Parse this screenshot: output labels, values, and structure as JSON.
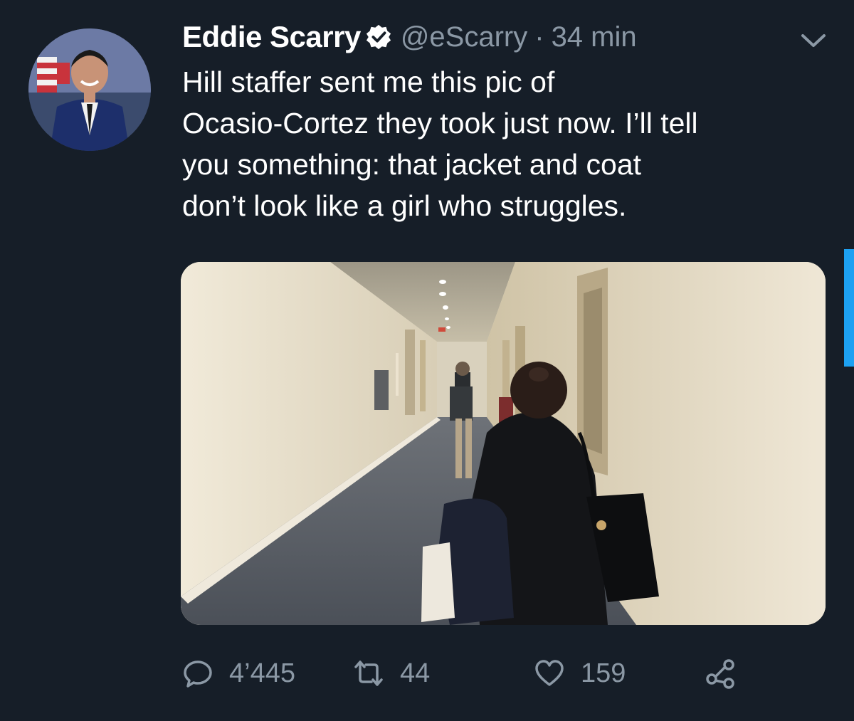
{
  "tweet": {
    "author": {
      "display_name": "Eddie Scarry",
      "handle": "@eScarry",
      "verified": true,
      "avatar_icon": "profile-photo"
    },
    "separator": "·",
    "timestamp": "34 min",
    "text_lines": [
      "Hill staffer sent me this pic of",
      "Ocasio-Cortez they took just now. I’ll tell",
      "you something: that jacket and coat",
      "don’t look like a girl who struggles."
    ],
    "media": {
      "type": "photo"
    },
    "actions": {
      "reply": {
        "icon": "reply-icon",
        "count": "4’445"
      },
      "retweet": {
        "icon": "retweet-icon",
        "count": "44"
      },
      "like": {
        "icon": "heart-icon",
        "count": "159"
      },
      "share": {
        "icon": "share-icon"
      }
    },
    "menu_icon": "chevron-down-icon"
  },
  "colors": {
    "background": "#161e28",
    "text": "#ffffff",
    "secondary_text": "#8b98a5",
    "accent": "#1da1f2"
  }
}
